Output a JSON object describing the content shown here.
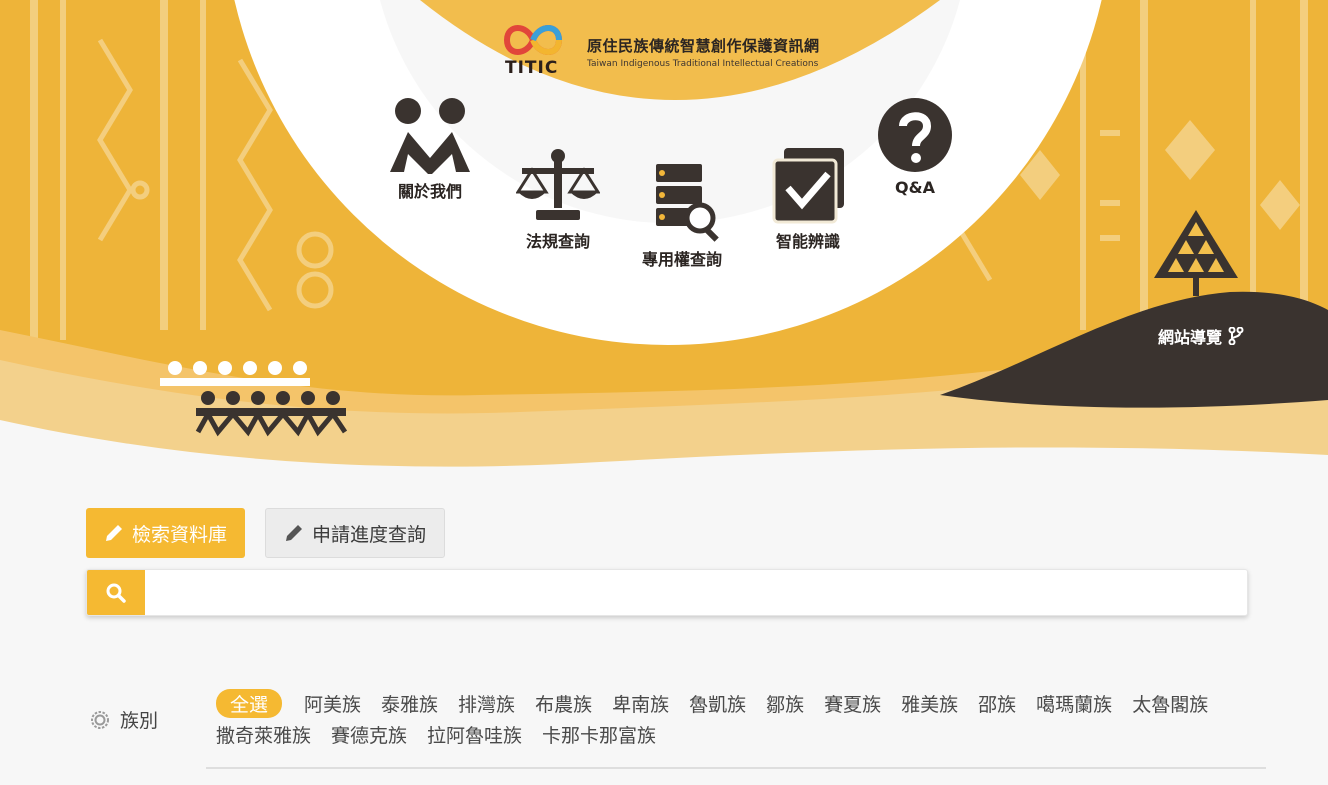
{
  "header": {
    "logo_short": "TITIC",
    "logo_title": "原住民族傳統智慧創作保護資訊網",
    "logo_subtitle": "Taiwan Indigenous Traditional Intellectual Creations"
  },
  "nav": {
    "about": "關於我們",
    "law": "法規查詢",
    "rights": "專用權查詢",
    "smart": "智能辨識",
    "qa": "Q&A",
    "sitemap": "網站導覽"
  },
  "tabs": {
    "search_db": "檢索資料庫",
    "progress": "申請進度查詢"
  },
  "search": {
    "value": "",
    "placeholder": ""
  },
  "filter": {
    "label": "族別",
    "row1": [
      "全選",
      "阿美族",
      "泰雅族",
      "排灣族",
      "布農族",
      "卑南族",
      "魯凱族",
      "鄒族",
      "賽夏族",
      "雅美族",
      "邵族",
      "噶瑪蘭族",
      "太魯閣族"
    ],
    "row2": [
      "撒奇萊雅族",
      "賽德克族",
      "拉阿魯哇族",
      "卡那卡那富族"
    ],
    "selected": "全選"
  },
  "colors": {
    "accent": "#f5b932",
    "dark": "#3a332f"
  }
}
